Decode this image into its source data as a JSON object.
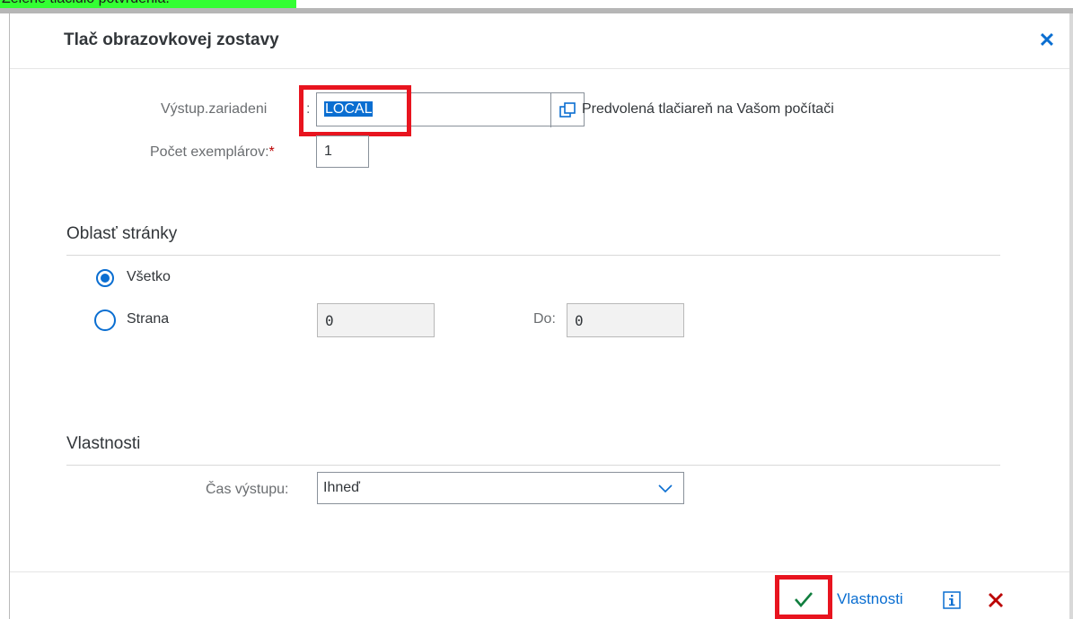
{
  "caption": "Zelené tlačidlo potvrdenia.",
  "dialog": {
    "title": "Tlač obrazovkovej zostavy",
    "close_icon": "close-icon"
  },
  "output_device": {
    "label": "Výstup.zariadeni",
    "label_colon": ":",
    "value": "LOCAL",
    "description": "Predvolená tlačiareň na Vašom počítači",
    "value_help_icon": "value-help-icon"
  },
  "copies": {
    "label": "Počet exemplárov:",
    "required_marker": "*",
    "value": "1"
  },
  "page_area": {
    "title": "Oblasť stránky",
    "all_label": "Všetko",
    "all_selected": true,
    "page_label": "Strana",
    "page_from": "0",
    "to_label": "Do:",
    "page_to": "0"
  },
  "properties": {
    "title": "Vlastnosti",
    "time_label": "Čas výstupu:",
    "time_value": "Ihneď",
    "dropdown_icon": "chevron-down-icon"
  },
  "footer": {
    "confirm_icon": "checkmark-icon",
    "properties_link": "Vlastnosti",
    "info_icon": "info-icon",
    "cancel_icon": "cancel-icon"
  },
  "colors": {
    "accent": "#0a6ed1",
    "highlight_box": "#e8141f",
    "caption_bg": "#33ff33",
    "confirm_green": "#107e3e",
    "cancel_red": "#bb0000"
  }
}
